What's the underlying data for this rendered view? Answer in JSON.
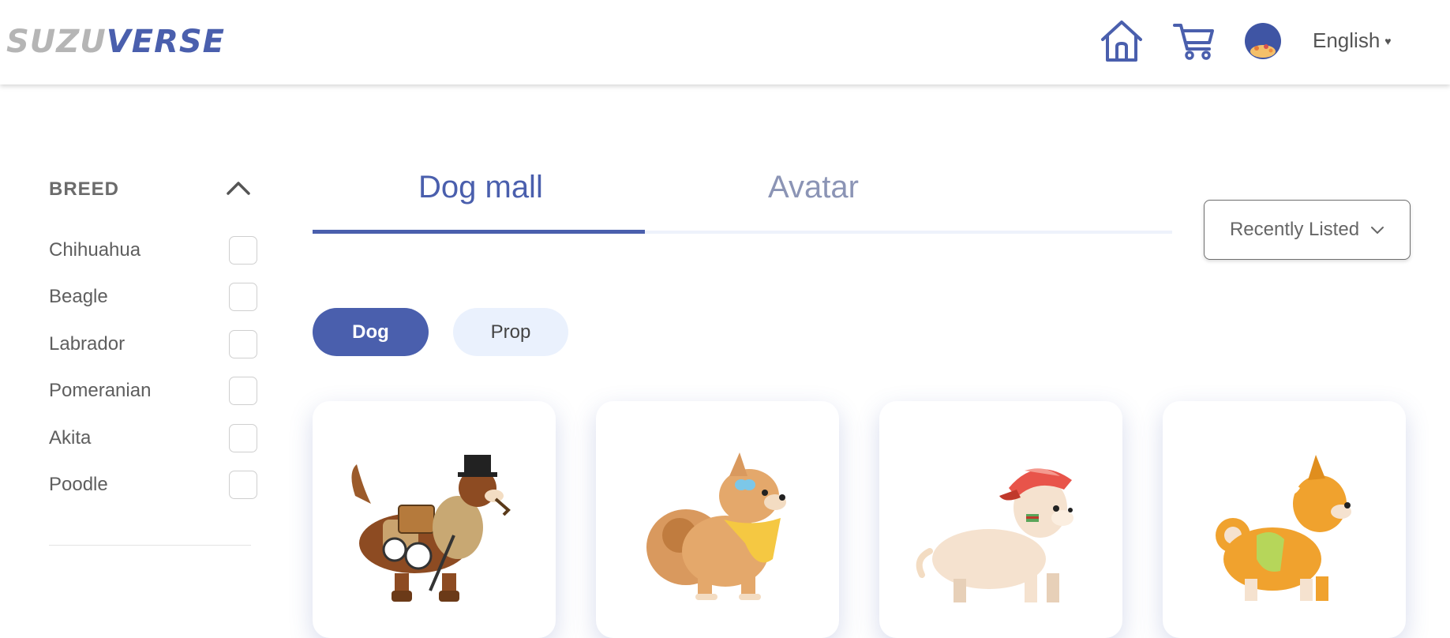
{
  "header": {
    "logo_part1": "SUZU",
    "logo_part2": "VERSE",
    "language": "English",
    "icons": [
      "home-icon",
      "cart-icon",
      "avatar"
    ]
  },
  "filters": {
    "breed_title": "BREED",
    "breeds": [
      "Chihuahua",
      "Beagle",
      "Labrador",
      "Pomeranian",
      "Akita",
      "Poodle"
    ]
  },
  "tabs": [
    {
      "label": "Dog mall",
      "active": true
    },
    {
      "label": "Avatar",
      "active": false
    }
  ],
  "sort": {
    "label": "Recently Listed"
  },
  "categories": [
    {
      "label": "Dog",
      "active": true
    },
    {
      "label": "Prop",
      "active": false
    }
  ],
  "products": [
    {
      "name": "dog-explorer-image"
    },
    {
      "name": "dog-pomeranian-butterfly-image"
    },
    {
      "name": "dog-red-cap-image"
    },
    {
      "name": "dog-shiba-green-image"
    }
  ],
  "colors": {
    "primary": "#4a5fad",
    "inactive_tab": "#8b94b5",
    "pill_light": "#eaf1fd"
  }
}
